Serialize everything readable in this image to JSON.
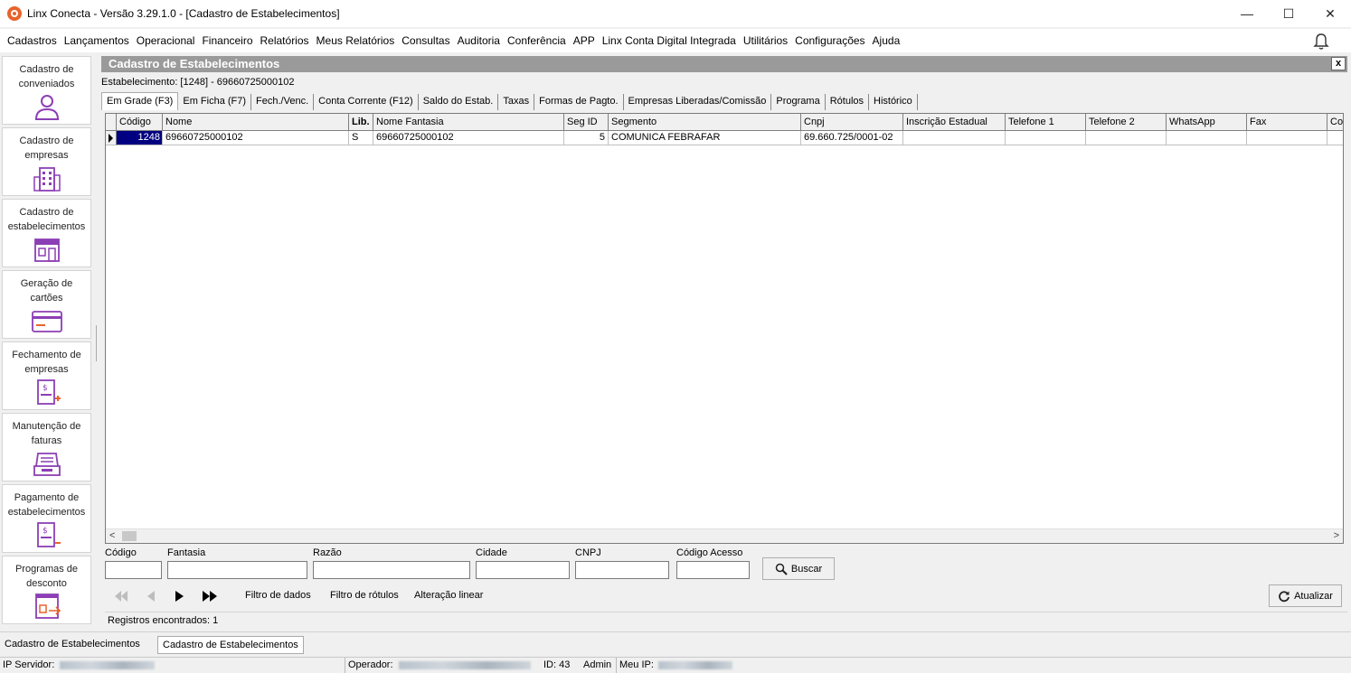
{
  "window": {
    "title": "Linx Conecta - Versão 3.29.1.0 - [Cadastro de Estabelecimentos]",
    "minimize": "—",
    "maximize": "☐",
    "close": "✕"
  },
  "menu": [
    "Cadastros",
    "Lançamentos",
    "Operacional",
    "Financeiro",
    "Relatórios",
    "Meus Relatórios",
    "Consultas",
    "Auditoria",
    "Conferência",
    "APP",
    "Linx Conta Digital Integrada",
    "Utilitários",
    "Configurações",
    "Ajuda"
  ],
  "sidebar": {
    "items": [
      {
        "label": "Cadastro de conveniados",
        "icon": "person-icon"
      },
      {
        "label": "Cadastro de empresas",
        "icon": "building-icon"
      },
      {
        "label": "Cadastro de estabelecimentos",
        "icon": "store-icon"
      },
      {
        "label": "Geração de cartões",
        "icon": "card-icon"
      },
      {
        "label": "Fechamento de empresas",
        "icon": "invoice-plus-icon"
      },
      {
        "label": "Manutenção de faturas",
        "icon": "tray-icon"
      },
      {
        "label": "Pagamento de estabelecimentos",
        "icon": "invoice-minus-icon"
      },
      {
        "label": "Programas de desconto",
        "icon": "discount-icon"
      }
    ]
  },
  "panel": {
    "title": "Cadastro de Estabelecimentos",
    "close": "x",
    "estabelecimento": "Estabelecimento: [1248] - 69660725000102"
  },
  "tabs": [
    "Em Grade (F3)",
    "Em Ficha (F7)",
    "Fech./Venc.",
    "Conta Corrente (F12)",
    "Saldo do Estab.",
    "Taxas",
    "Formas de Pagto.",
    "Empresas Liberadas/Comissão",
    "Programa",
    "Rótulos",
    "Histórico"
  ],
  "grid": {
    "columns": [
      "Código",
      "Nome",
      "Lib.",
      "Nome Fantasia",
      "Seg ID",
      "Segmento",
      "Cnpj",
      "Inscrição Estadual",
      "Telefone 1",
      "Telefone 2",
      "WhatsApp",
      "Fax",
      "Co"
    ],
    "rows": [
      [
        "1248",
        "69660725000102",
        "S",
        "69660725000102",
        "5",
        "COMUNICA FEBRAFAR",
        "69.660.725/0001-02",
        "",
        "",
        "",
        "",
        "",
        ""
      ]
    ]
  },
  "filters": {
    "codigo": "Código",
    "fantasia": "Fantasia",
    "razao": "Razão",
    "cidade": "Cidade",
    "cnpj": "CNPJ",
    "codigo_acesso": "Código Acesso",
    "buscar": "Buscar"
  },
  "actions": {
    "filtro_dados": "Filtro de dados",
    "filtro_rotulos": "Filtro de rótulos",
    "alteracao_linear": "Alteração linear",
    "atualizar": "Atualizar"
  },
  "records": "Registros encontrados: 1",
  "bottom_tabs": [
    "Cadastro de Estabelecimentos",
    "Cadastro de Estabelecimentos"
  ],
  "status": {
    "ip_servidor": "IP Servidor:",
    "operador": "Operador:",
    "id": "ID: 43",
    "admin": "Admin",
    "meu_ip": "Meu IP:"
  }
}
